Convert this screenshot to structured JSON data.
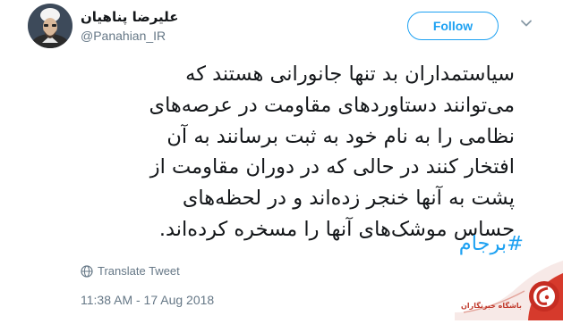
{
  "author": {
    "name": "علیرضا پناهیان",
    "handle": "@Panahian_IR"
  },
  "follow_button": {
    "label": "Follow"
  },
  "tweet": {
    "lines": [
      "سیاستمداران بد تنها جانورانی هستند که",
      "می‌توانند دستاوردهای مقاومت در عرصه‌های",
      "نظامی را به نام خود به ثبت برسانند به آن",
      "افتخار کنند در حالی که در دوران مقاومت از",
      "پشت به آنها خنجر زده‌اند و در لحظه‌های",
      "حساس موشک‌های آنها را مسخره کرده‌اند."
    ],
    "hashtag": "#برجام"
  },
  "translate": {
    "label": "Translate Tweet"
  },
  "timestamp": "11:38 AM - 17 Aug 2018",
  "watermark": {
    "caption": "باشگاه خبرنگاران"
  },
  "colors": {
    "accent": "#1da1f2",
    "text": "#14171a",
    "secondary": "#657786",
    "watermark_red": "#c0392b"
  },
  "icons": {
    "chevron": "chevron-down-icon",
    "translate": "globe-icon",
    "watermark": "news-agency-logo"
  }
}
